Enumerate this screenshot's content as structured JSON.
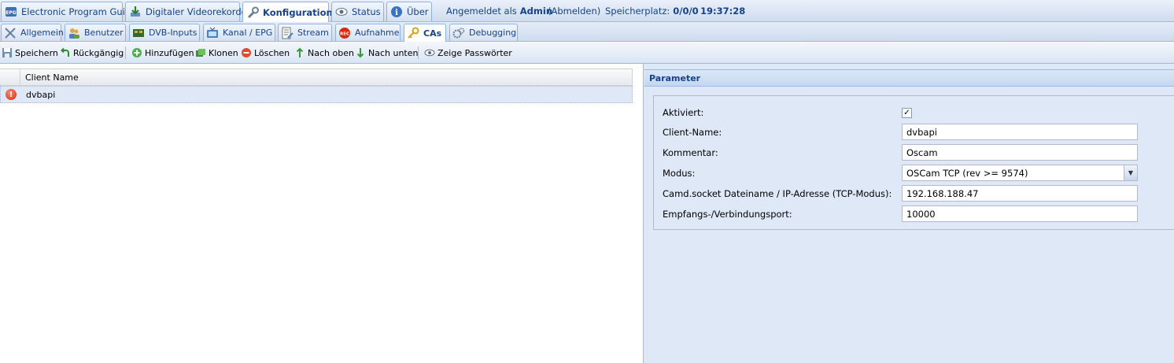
{
  "top_tabs": [
    {
      "label": "Electronic Program Guide",
      "icon": "epg-icon"
    },
    {
      "label": "Digitaler Videorekorder",
      "icon": "download-icon"
    },
    {
      "label": "Konfiguration",
      "icon": "wrench-icon",
      "active": true
    },
    {
      "label": "Status",
      "icon": "eye-icon"
    },
    {
      "label": "Über",
      "icon": "info-icon"
    }
  ],
  "session": {
    "logged_in_prefix": "Angemeldet als",
    "user": "Admin",
    "logout_label": "(Abmelden)",
    "storage_prefix": "Speicherplatz:",
    "storage_value": "0/0/0",
    "time": "19:37:28"
  },
  "sub_tabs": [
    {
      "label": "Allgemein",
      "icon": "tools-icon"
    },
    {
      "label": "Benutzer",
      "icon": "users-icon"
    },
    {
      "label": "DVB-Inputs",
      "icon": "card-icon"
    },
    {
      "label": "Kanal / EPG",
      "icon": "tv-icon"
    },
    {
      "label": "Stream",
      "icon": "stream-icon"
    },
    {
      "label": "Aufnahme",
      "icon": "rec-icon"
    },
    {
      "label": "CAs",
      "icon": "key-icon",
      "active": true
    },
    {
      "label": "Debugging",
      "icon": "gears-icon"
    }
  ],
  "toolbar": {
    "save": "Speichern",
    "undo": "Rückgängig",
    "add": "Hinzufügen",
    "clone": "Klonen",
    "delete": "Löschen",
    "move_up": "Nach oben",
    "move_down": "Nach unten",
    "show_passwords": "Zeige Passwörter"
  },
  "grid": {
    "column_header": "Client Name",
    "rows": [
      {
        "name": "dvbapi",
        "status_icon": "error-icon"
      }
    ]
  },
  "parameter": {
    "title": "Parameter",
    "fields": {
      "enabled_label": "Aktiviert:",
      "enabled_value": "✓",
      "client_name_label": "Client-Name:",
      "client_name_value": "dvbapi",
      "comment_label": "Kommentar:",
      "comment_value": "Oscam",
      "mode_label": "Modus:",
      "mode_value": "OSCam TCP (rev >= 9574)",
      "camd_label": "Camd.socket Dateiname / IP-Adresse (TCP-Modus):",
      "camd_value": "192.168.188.47",
      "port_label": "Empfangs-/Verbindungsport:",
      "port_value": "10000"
    }
  },
  "colors": {
    "accent": "#15428b",
    "panel_bg": "#dfe8f6",
    "border": "#99bbe8",
    "error": "#d62b0f"
  }
}
